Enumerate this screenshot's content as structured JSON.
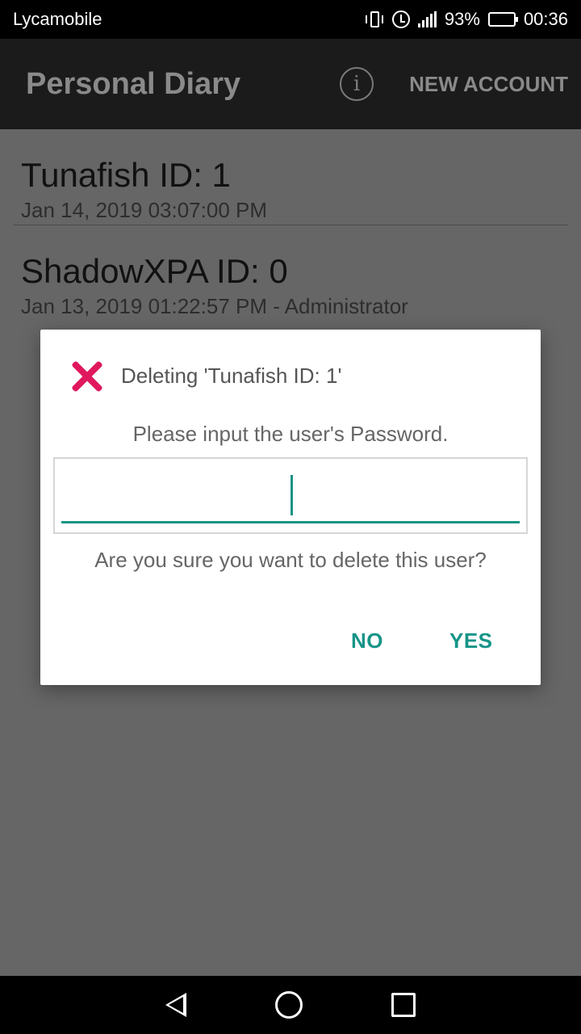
{
  "status_bar": {
    "carrier": "Lycamobile",
    "battery_percent": "93%",
    "time": "00:36",
    "icons": [
      "vibrate-icon",
      "alarm-icon",
      "signal-icon",
      "battery-icon"
    ]
  },
  "app_bar": {
    "title": "Personal Diary",
    "info_icon": "i",
    "new_account_label": "NEW ACCOUNT"
  },
  "users": [
    {
      "name": "Tunafish ID: 1",
      "subtitle": "Jan 14, 2019 03:07:00 PM"
    },
    {
      "name": "ShadowXPA ID: 0",
      "subtitle": "Jan 13, 2019 01:22:57 PM - Administrator"
    }
  ],
  "dialog": {
    "icon": "close-x-icon",
    "title": "Deleting 'Tunafish ID: 1'",
    "message": "Please input the user's Password.",
    "password_value": "",
    "question": "Are you sure you want to delete this user?",
    "no_label": "NO",
    "yes_label": "YES"
  },
  "colors": {
    "accent": "#179488",
    "delete_icon": "#e0195e",
    "scrim_background": "#666666"
  },
  "nav_bar": {
    "icons": [
      "back-icon",
      "home-icon",
      "recents-icon"
    ]
  }
}
